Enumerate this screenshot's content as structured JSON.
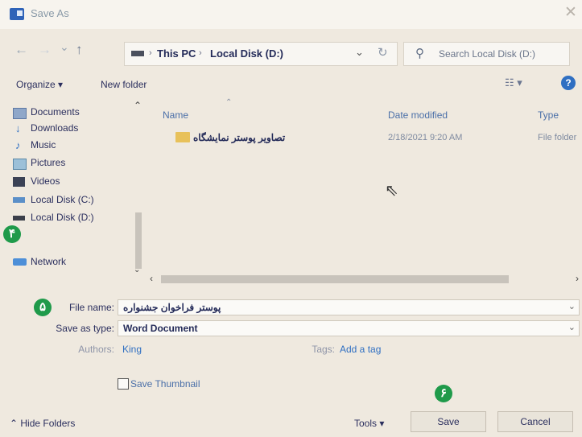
{
  "window": {
    "title": "Save As",
    "close_glyph": "✕"
  },
  "nav": {
    "back": "←",
    "forward": "→",
    "down": "⌄",
    "up": "↑"
  },
  "address": {
    "segments": [
      "This PC",
      "Local Disk (D:)"
    ],
    "separator": "›",
    "dropdown": "⌄",
    "refresh": "↻"
  },
  "search": {
    "placeholder": "Search Local Disk (D:)"
  },
  "toolbar": {
    "organize": "Organize ▾",
    "new_folder": "New folder",
    "view": "☷ ▾",
    "help": "?"
  },
  "sidebar": {
    "items": [
      {
        "label": "Documents",
        "icon": "documents-icon"
      },
      {
        "label": "Downloads",
        "icon": "downloads-icon"
      },
      {
        "label": "Music",
        "icon": "music-icon"
      },
      {
        "label": "Pictures",
        "icon": "pictures-icon"
      },
      {
        "label": "Videos",
        "icon": "videos-icon"
      },
      {
        "label": "Local Disk (C:)",
        "icon": "drive-icon"
      },
      {
        "label": "Local Disk (D:)",
        "icon": "drive-icon"
      },
      {
        "label": "Network",
        "icon": "network-icon"
      }
    ]
  },
  "columns": {
    "name": "Name",
    "date": "Date modified",
    "type": "Type"
  },
  "files": [
    {
      "name": "تصاویر پوستر نمایشگاه",
      "date": "2/18/2021 9:20 AM",
      "type": "File folder"
    }
  ],
  "badges": {
    "b4": "۴",
    "b5": "۵",
    "b6": "۶"
  },
  "form": {
    "file_name_label": "File name:",
    "file_name_value": "پوستر فراخوان جشنواره",
    "save_type_label": "Save as type:",
    "save_type_value": "Word Document",
    "authors_label": "Authors:",
    "authors_value": "King",
    "tags_label": "Tags:",
    "tags_value": "Add a tag",
    "thumbnail_label": "Save Thumbnail"
  },
  "footer": {
    "hide_folders": "Hide Folders",
    "tools": "Tools ▾",
    "save": "Save",
    "cancel": "Cancel"
  },
  "colors": {
    "accent": "#2f6fc2",
    "badge": "#1f9a4a",
    "folder": "#e8c15a"
  }
}
